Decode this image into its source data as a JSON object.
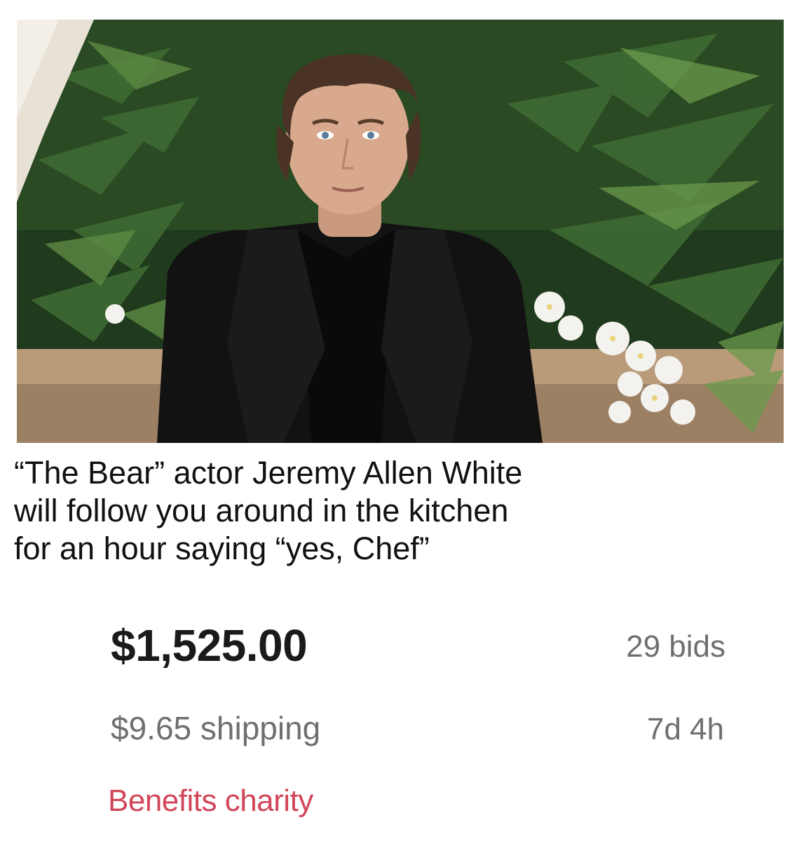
{
  "photo": {
    "subject": "man-in-black-suit",
    "background": "tropical-plants-and-white-orchids",
    "colors": {
      "foliage": "#24441f",
      "foliage_light": "#4f7a3a",
      "suit": "#121212",
      "skin": "#d8a98c",
      "hair": "#4a3224",
      "orchid": "#f4f2ee",
      "curtain": "#e7e1d6"
    }
  },
  "caption": {
    "line1": "“The Bear” actor Jeremy Allen White",
    "line2": "will follow you around in the kitchen",
    "line3": "for an hour saying “yes, Chef”"
  },
  "listing": {
    "price": "$1,525.00",
    "bids": "29 bids",
    "shipping": "$9.65 shipping",
    "time_left": "7d 4h",
    "charity": "Benefits charity"
  },
  "colors": {
    "price": "#1a1a1a",
    "meta": "#6f6f6f",
    "charity": "#d1465a"
  }
}
